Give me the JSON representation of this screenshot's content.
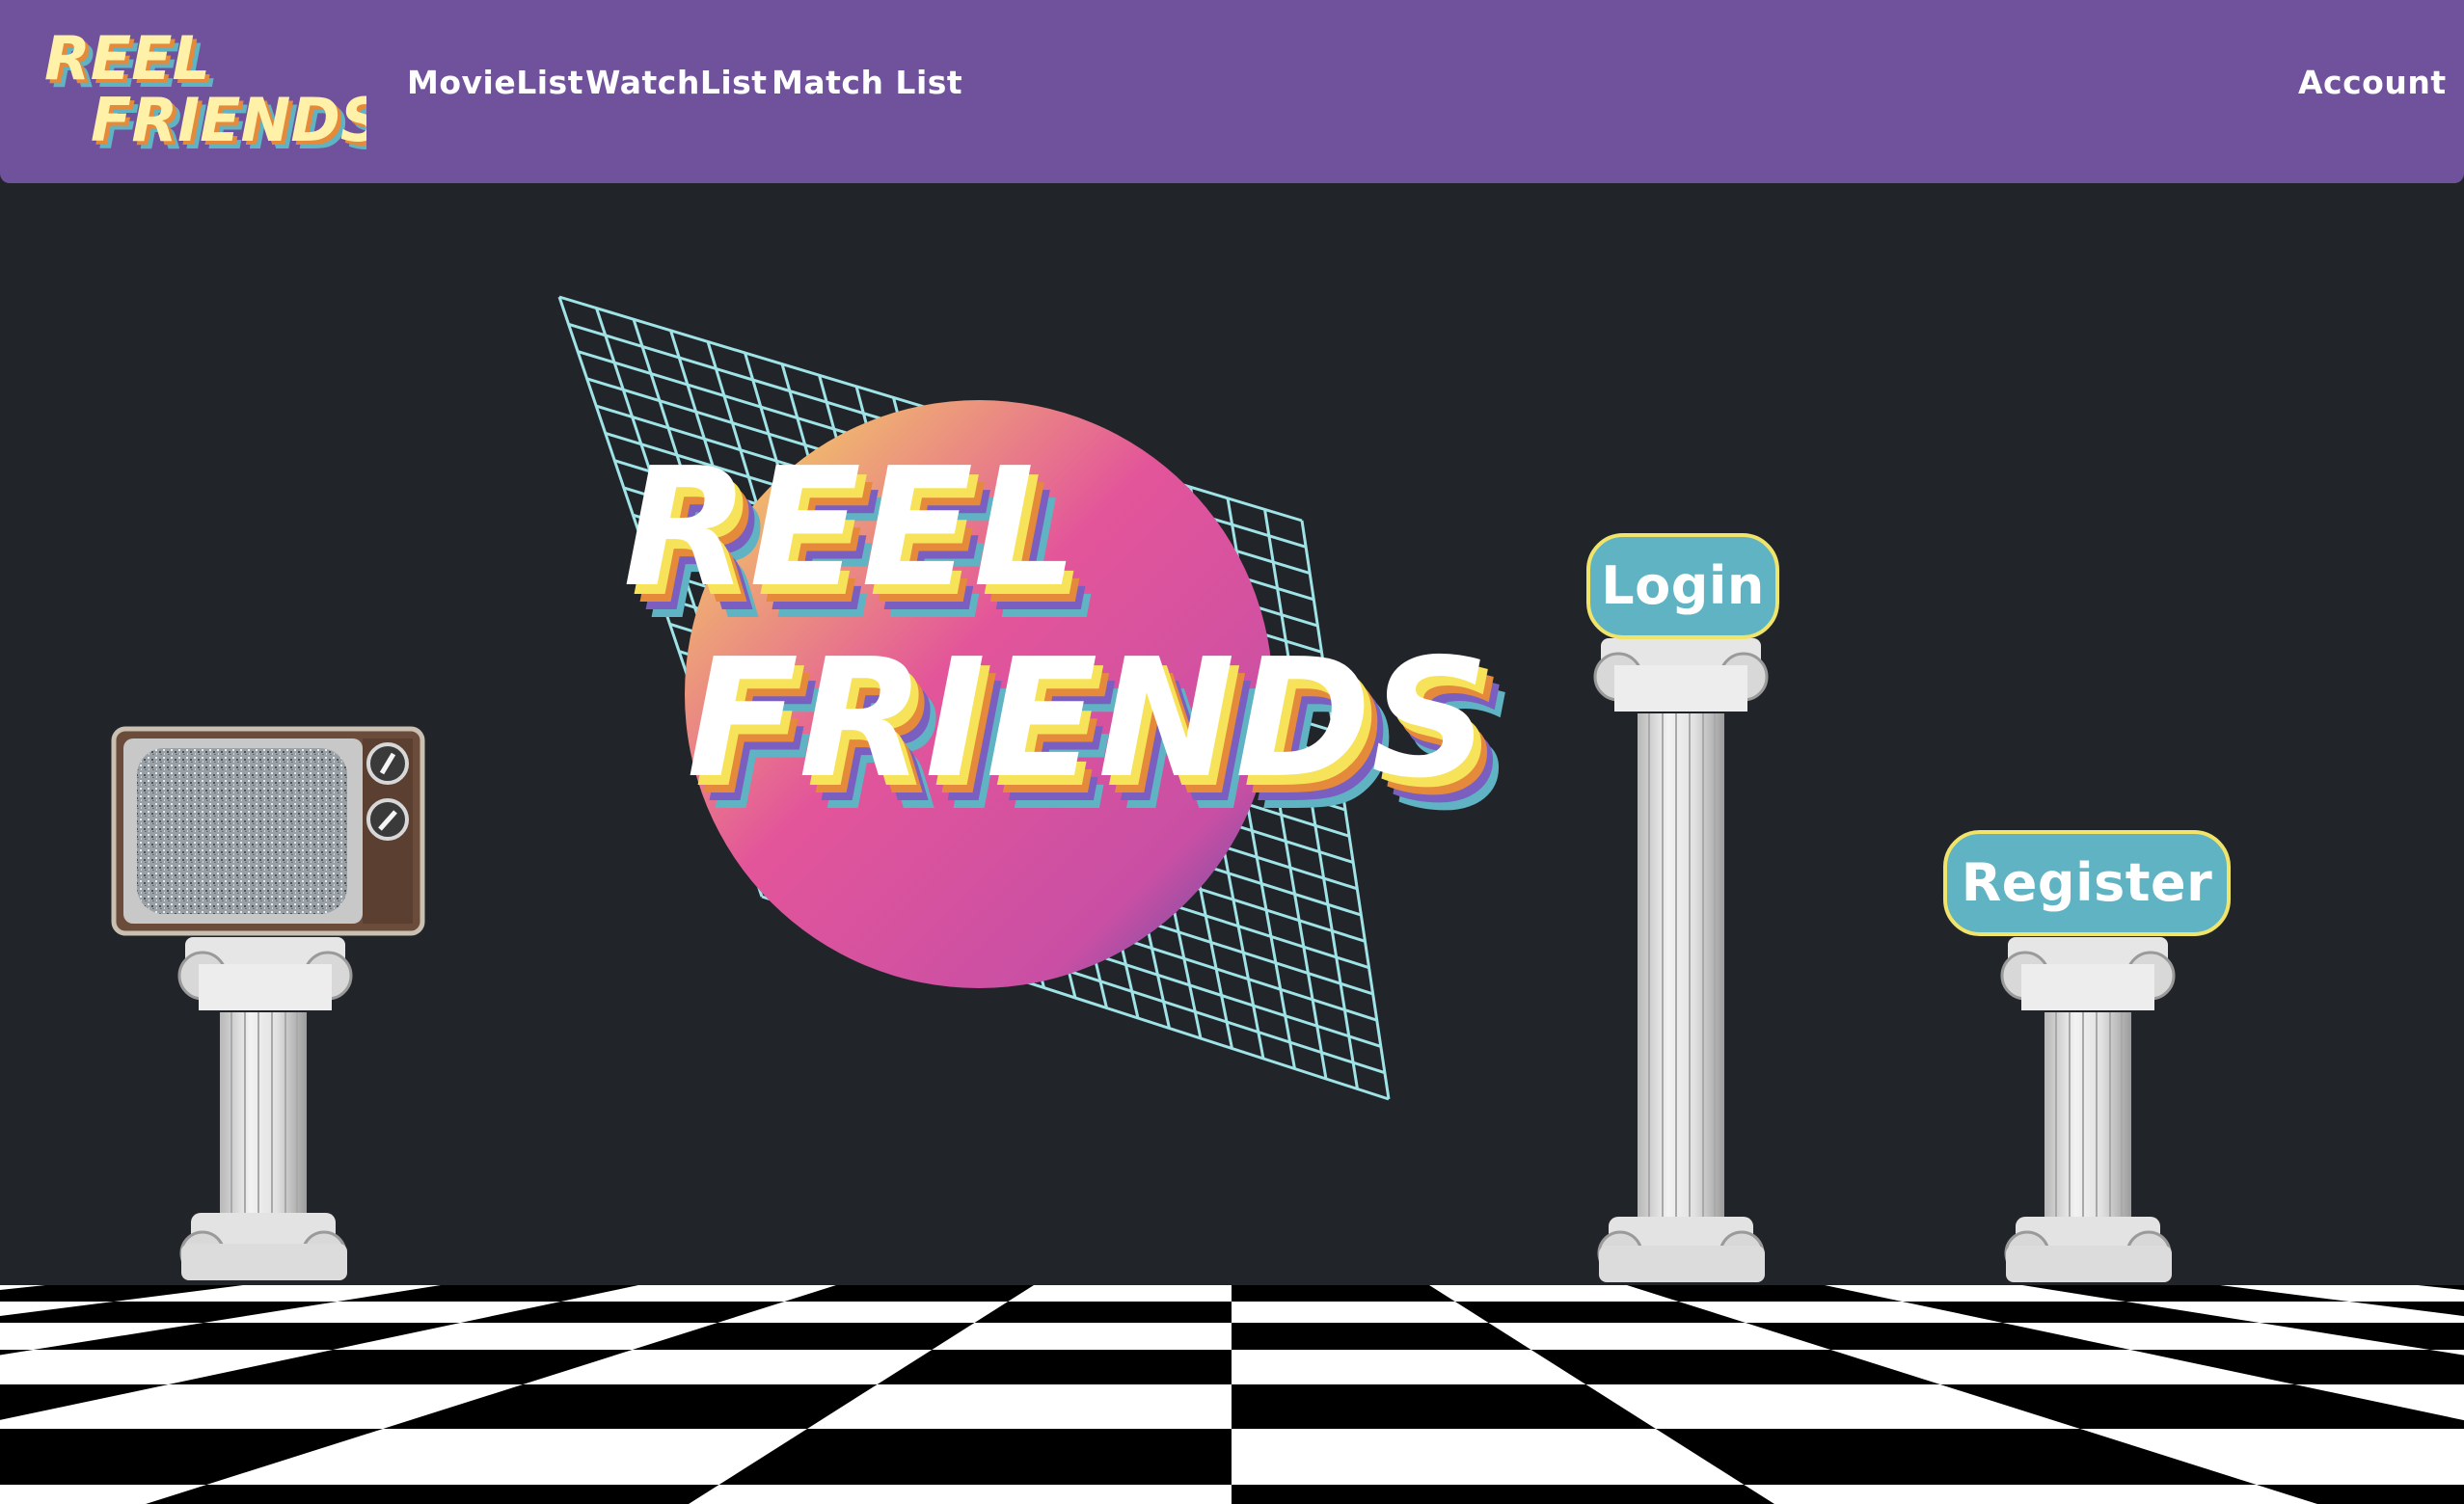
{
  "brand": {
    "line1": "REEL",
    "line2": "FRIENDS"
  },
  "nav": {
    "items": [
      {
        "label": "MovieList"
      },
      {
        "label": "WatchList"
      },
      {
        "label": "Match List"
      }
    ],
    "account_label": "Account"
  },
  "hero": {
    "line1": "REEL",
    "line2": "FRIENDS"
  },
  "actions": {
    "login_label": "Login",
    "register_label": "Register"
  },
  "colors": {
    "navbar": "#6f519c",
    "background": "#212429",
    "button_fill": "#5fb3c3",
    "button_border": "#f1e46a",
    "grid": "#9fe3e6"
  },
  "icons": [
    "tv-icon",
    "column-icon"
  ]
}
